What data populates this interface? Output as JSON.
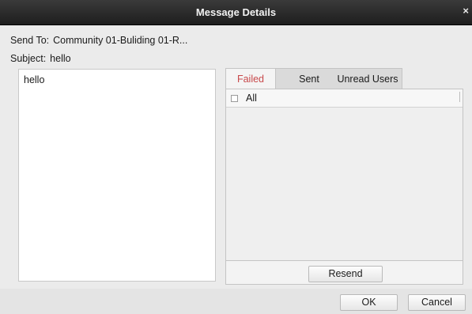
{
  "window": {
    "title": "Message Details",
    "close_glyph": "×"
  },
  "send_to": {
    "label": "Send To:",
    "value": "Community 01-Buliding 01-R..."
  },
  "subject": {
    "label": "Subject:",
    "value": "hello"
  },
  "message": {
    "body": "hello"
  },
  "tabs": [
    {
      "label": "Failed",
      "active": true
    },
    {
      "label": "Sent",
      "active": false
    },
    {
      "label": "Unread Users",
      "active": false
    }
  ],
  "list": {
    "all_label": "All",
    "all_checked": false
  },
  "buttons": {
    "resend": "Resend",
    "ok": "OK",
    "cancel": "Cancel"
  },
  "colors": {
    "active_tab_text": "#c8494b",
    "titlebar": "#2b2b2b"
  }
}
